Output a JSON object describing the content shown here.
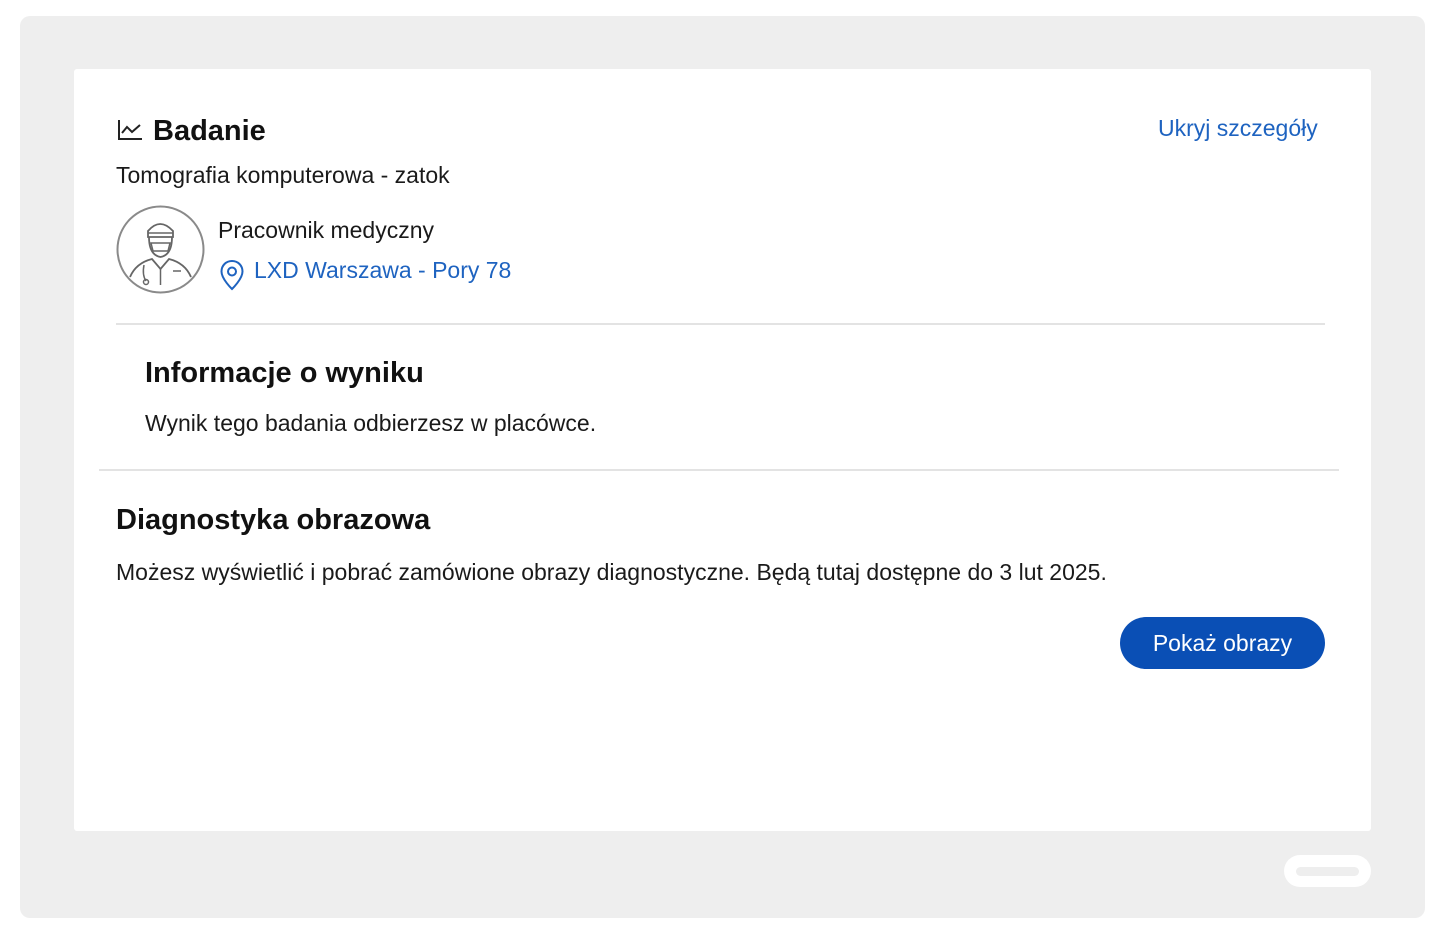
{
  "exam": {
    "title": "Badanie",
    "hide_details_label": "Ukryj szczegóły",
    "name": "Tomografia komputerowa - zatok",
    "staff_role": "Pracownik medyczny",
    "location": "LXD Warszawa - Pory 78",
    "header_icon": "line-chart-icon",
    "avatar_icon": "medical-staff-avatar-icon",
    "location_icon": "map-pin-icon"
  },
  "result_info": {
    "title": "Informacje o wyniku",
    "text": "Wynik tego badania odbierzesz w placówce."
  },
  "imaging": {
    "title": "Diagnostyka obrazowa",
    "text": "Możesz wyświetlić i pobrać zamówione obrazy diagnostyczne. Będą tutaj dostępne do 3 lut 2025.",
    "button_label": "Pokaż obrazy"
  },
  "colors": {
    "accent": "#0a4fb5",
    "link": "#1e63c0",
    "background": "#eeeeee"
  }
}
